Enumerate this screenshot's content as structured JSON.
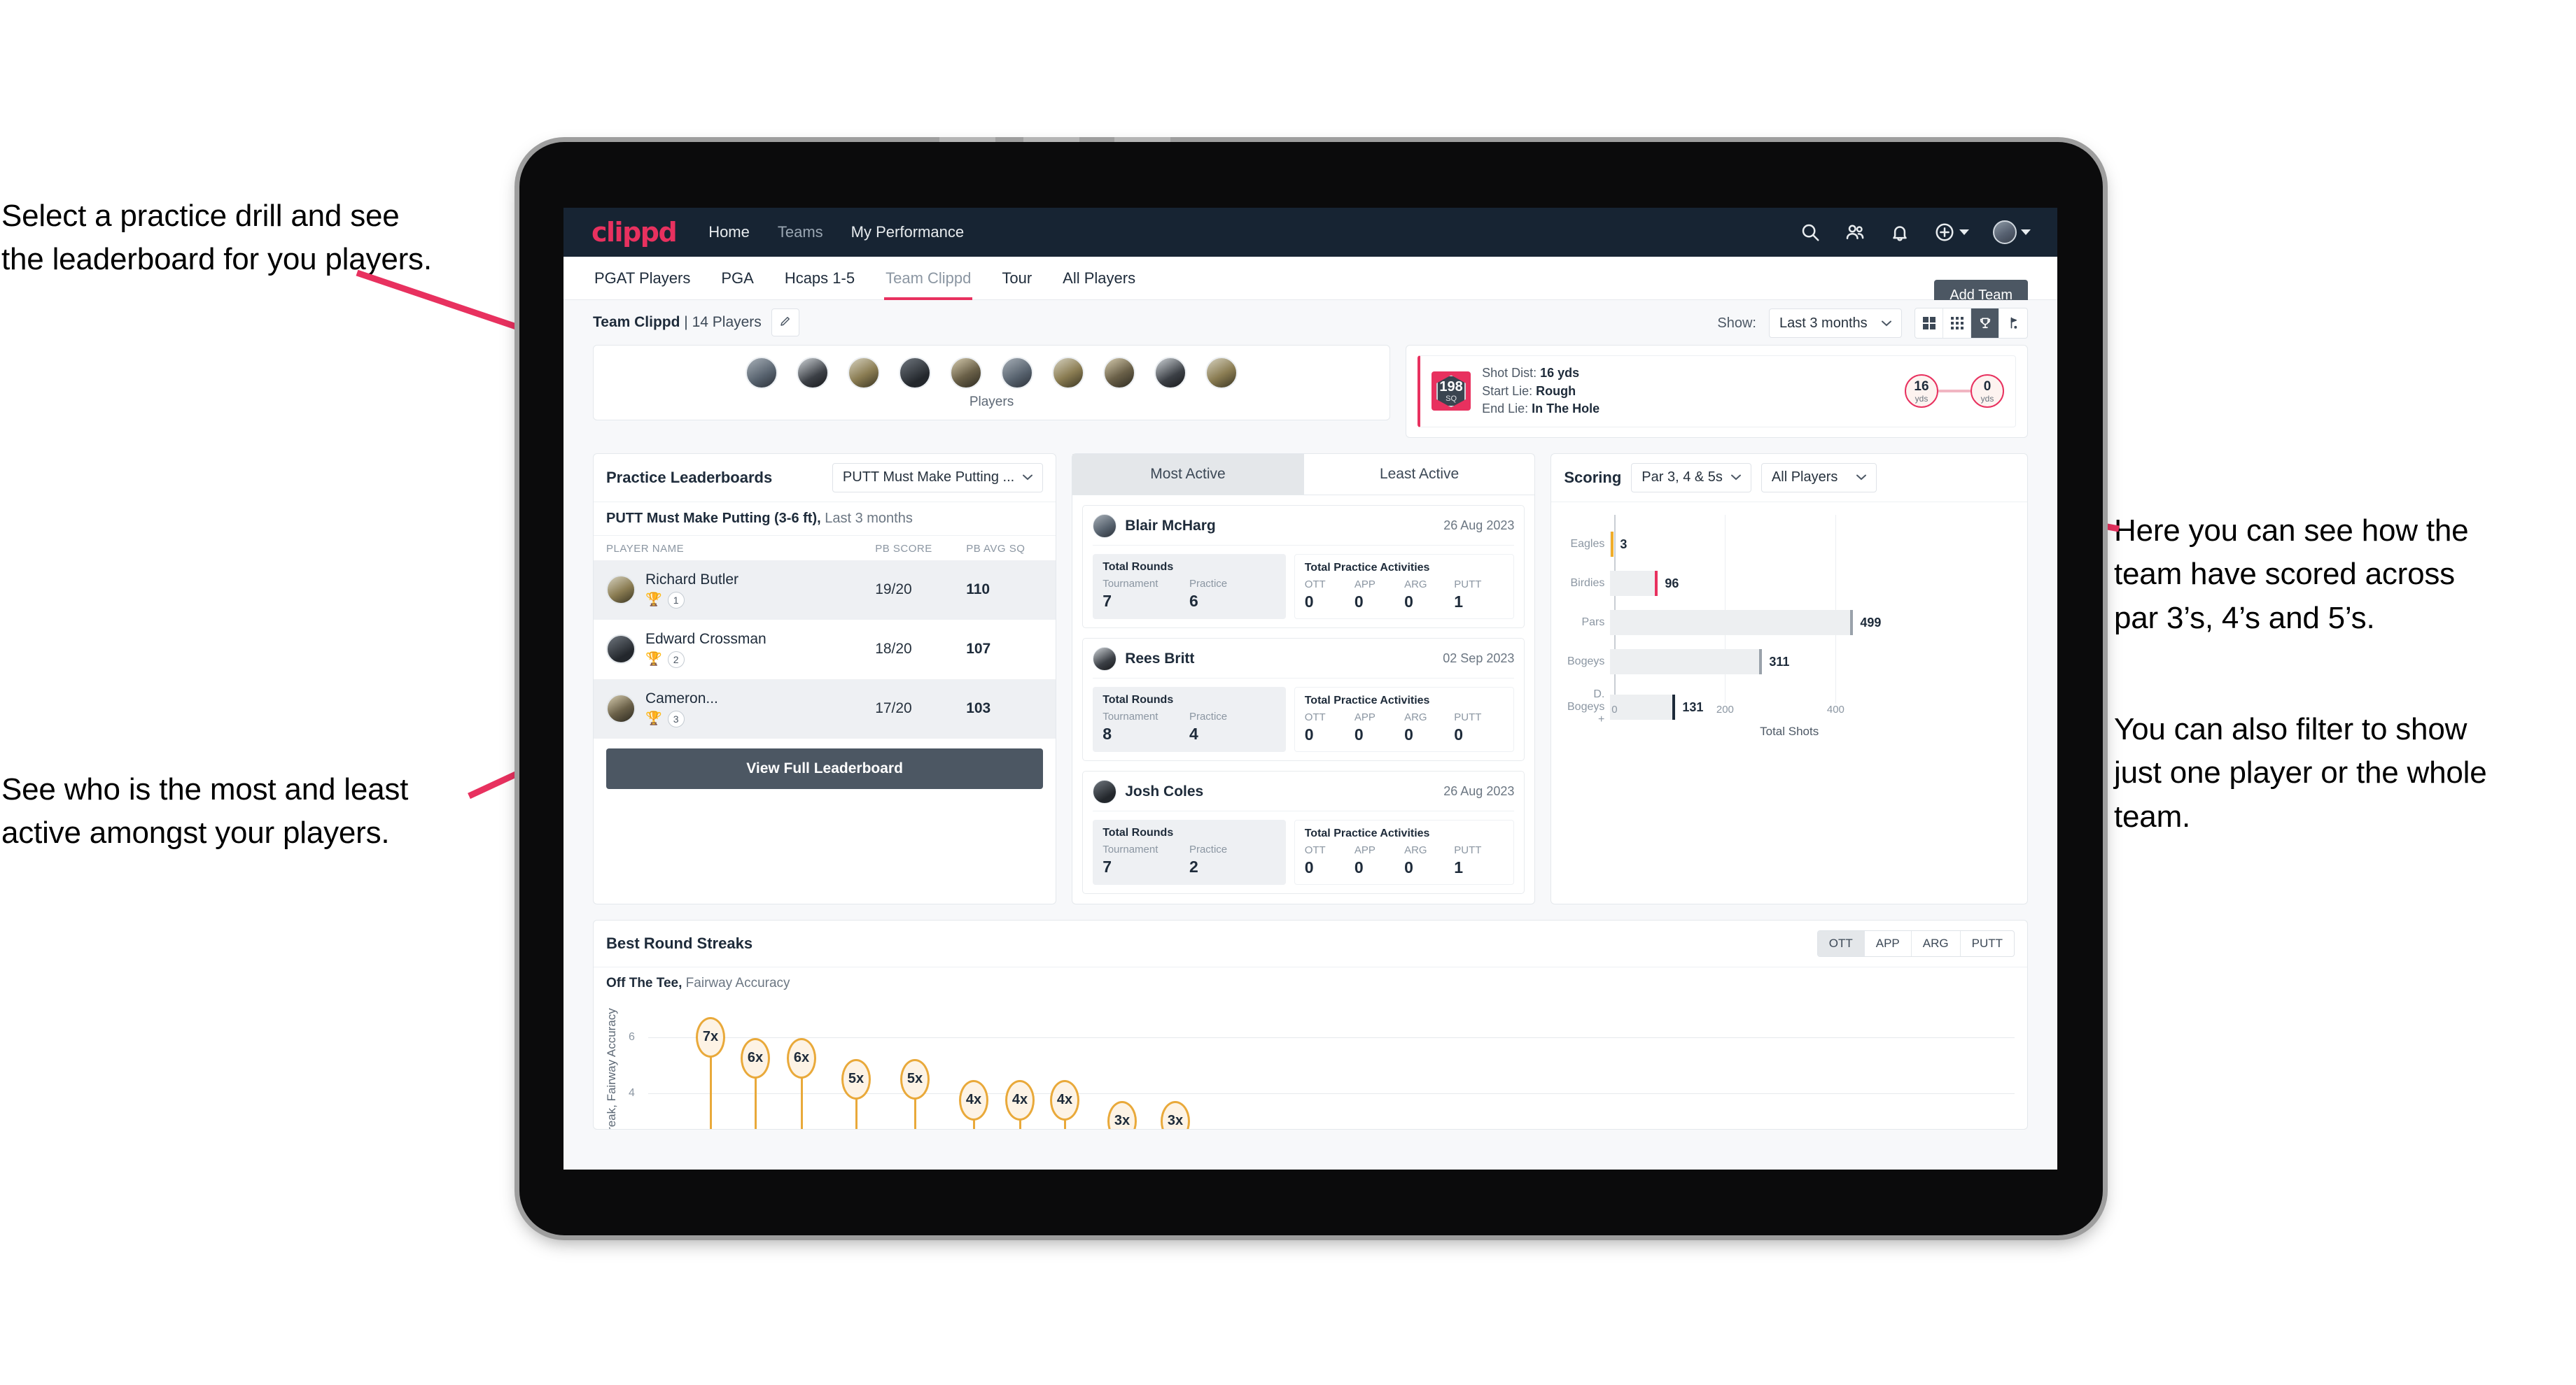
{
  "annotations": {
    "left_top": [
      "Select a practice drill and see",
      "the leaderboard for you players."
    ],
    "left_bottom": [
      "See who is the most and least",
      "active amongst your players."
    ],
    "right_top": [
      "Here you can see how the",
      "team have scored across",
      "par 3’s, 4’s and 5’s."
    ],
    "right_bottom": [
      "You can also filter to show",
      "just one player or the whole",
      "team."
    ]
  },
  "topnav": {
    "brand": "clippd",
    "links": [
      {
        "label": "Home",
        "active": true
      },
      {
        "label": "Teams",
        "active": false
      },
      {
        "label": "My Performance",
        "active": true
      }
    ],
    "icons": [
      "search-icon",
      "people-icon",
      "bell-icon",
      "plus-circle-icon",
      "avatar"
    ]
  },
  "tabs": [
    {
      "label": "PGAT Players",
      "active": false
    },
    {
      "label": "PGA",
      "active": false
    },
    {
      "label": "Hcaps 1-5",
      "active": false
    },
    {
      "label": "Team Clippd",
      "active": true
    },
    {
      "label": "Tour",
      "active": false
    },
    {
      "label": "All Players",
      "active": false
    }
  ],
  "add_team_label": "Add Team",
  "pagebar": {
    "team_name": "Team Clippd",
    "team_sep": " | ",
    "team_count": "14 Players",
    "edit_icon": "pencil-icon",
    "show_label": "Show:",
    "range_value": "Last 3 months",
    "view_modes": [
      {
        "name": "grid-large-icon",
        "on": false
      },
      {
        "name": "grid-small-icon",
        "on": false
      },
      {
        "name": "trophy-icon",
        "on": true
      },
      {
        "name": "flag-icon",
        "on": false
      }
    ]
  },
  "players_strip": {
    "label": "Players",
    "count": 10
  },
  "shot_card": {
    "sq_value": "198",
    "sq_unit": "SQ",
    "lines": [
      {
        "key": "Shot Dist:",
        "value": "16 yds"
      },
      {
        "key": "Start Lie:",
        "value": "Rough"
      },
      {
        "key": "End Lie:",
        "value": "In The Hole"
      }
    ],
    "start_dist": "16",
    "start_unit": "yds",
    "end_dist": "0",
    "end_unit": "yds"
  },
  "leaderboard": {
    "title": "Practice Leaderboards",
    "drill_select": "PUTT Must Make Putting ...",
    "subtitle_bold": "PUTT Must Make Putting (3-6 ft),",
    "subtitle_rest": " Last 3 months",
    "columns": [
      "PLAYER NAME",
      "PB SCORE",
      "PB AVG SQ"
    ],
    "rows": [
      {
        "name": "Richard Butler",
        "rank": "1",
        "trophy": "gold",
        "score": "19/20",
        "sq": "110"
      },
      {
        "name": "Edward Crossman",
        "rank": "2",
        "trophy": "silver",
        "score": "18/20",
        "sq": "107"
      },
      {
        "name": "Cameron...",
        "rank": "3",
        "trophy": "bronze",
        "score": "17/20",
        "sq": "103"
      }
    ],
    "button": "View Full Leaderboard"
  },
  "activity": {
    "segments": [
      {
        "label": "Most Active",
        "on": true
      },
      {
        "label": "Least Active",
        "on": false
      }
    ],
    "rounds_label": "Total Rounds",
    "rounds_keys": [
      "Tournament",
      "Practice"
    ],
    "practice_label": "Total Practice Activities",
    "practice_keys": [
      "OTT",
      "APP",
      "ARG",
      "PUTT"
    ],
    "cards": [
      {
        "name": "Blair McHarg",
        "date": "26 Aug 2023",
        "rounds": [
          "7",
          "6"
        ],
        "practice": [
          "0",
          "0",
          "0",
          "1"
        ]
      },
      {
        "name": "Rees Britt",
        "date": "02 Sep 2023",
        "rounds": [
          "8",
          "4"
        ],
        "practice": [
          "0",
          "0",
          "0",
          "0"
        ]
      },
      {
        "name": "Josh Coles",
        "date": "26 Aug 2023",
        "rounds": [
          "7",
          "2"
        ],
        "practice": [
          "0",
          "0",
          "0",
          "1"
        ]
      }
    ]
  },
  "scoring": {
    "title": "Scoring",
    "par_select": "Par 3, 4 & 5s",
    "player_select": "All Players"
  },
  "streaks": {
    "title": "Best Round Streaks",
    "segments": [
      {
        "label": "OTT",
        "on": true
      },
      {
        "label": "APP",
        "on": false
      },
      {
        "label": "ARG",
        "on": false
      },
      {
        "label": "PUTT",
        "on": false
      }
    ],
    "sub_bold": "Off The Tee,",
    "sub_rest": " Fairway Accuracy"
  },
  "chart_data": [
    {
      "type": "bar",
      "orientation": "horizontal",
      "title": "Scoring",
      "categories": [
        "Eagles",
        "Birdies",
        "Pars",
        "Bogeys",
        "D. Bogeys +"
      ],
      "values": [
        3,
        96,
        499,
        311,
        131
      ],
      "cap_colors": [
        "#f0ad2b",
        "#e8315f",
        "#9aa2ab",
        "#9aa2ab",
        "#1e2b3a"
      ],
      "xlabel": "Total Shots",
      "ylabel": "",
      "xlim": [
        0,
        520
      ],
      "xticks": [
        0,
        200,
        400
      ],
      "grid": true,
      "legend": "none"
    },
    {
      "type": "bar",
      "orientation": "vertical",
      "title": "Best Round Streaks",
      "subtitle": "Off The Tee, Fairway Accuracy",
      "ylabel": "Streak, Fairway Accuracy",
      "values": [
        7,
        6,
        6,
        5,
        5,
        4,
        4,
        4,
        3,
        3
      ],
      "labels": [
        "7x",
        "6x",
        "6x",
        "5x",
        "5x",
        "4x",
        "4x",
        "4x",
        "3x",
        "3x"
      ],
      "yticks": [
        4,
        6
      ],
      "ylim": [
        0,
        8
      ],
      "grid": true,
      "legend": "none"
    }
  ]
}
